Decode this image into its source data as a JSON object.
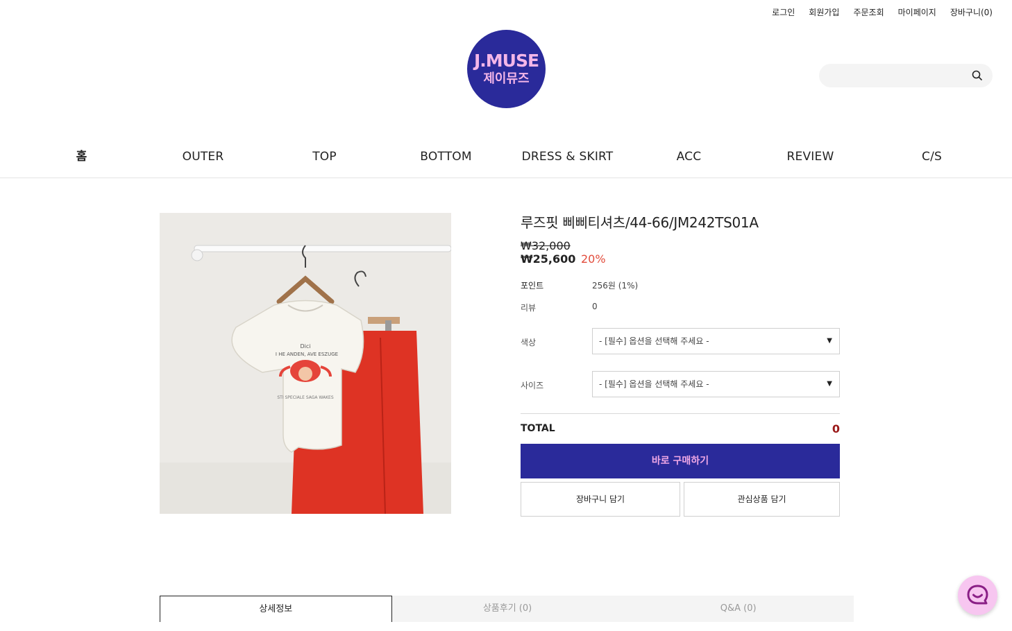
{
  "top_links": {
    "login": "로그인",
    "join": "회원가입",
    "order": "주문조회",
    "mypage": "마이페이지",
    "cart": "장바구니(0)"
  },
  "logo": {
    "en": "J.MUSE",
    "ko": "제이뮤즈"
  },
  "search": {
    "placeholder": ""
  },
  "nav": {
    "home": "홈",
    "outer": "OUTER",
    "top": "TOP",
    "bottom": "BOTTOM",
    "dress": "DRESS & SKIRT",
    "acc": "ACC",
    "review": "REVIEW",
    "cs": "C/S"
  },
  "product": {
    "title": "루즈핏 삐삐티셔츠/44-66/JM242TS01A",
    "price_original": "₩32,000",
    "price_sale": "₩25,600",
    "discount": "20%",
    "point_label": "포인트",
    "point_value": "256원 (1%)",
    "review_label": "리뷰",
    "review_value": "0",
    "color_label": "색상",
    "color_option": "- [필수] 옵션을 선택해 주세요 -",
    "size_label": "사이즈",
    "size_option": "- [필수] 옵션을 선택해 주세요 -",
    "total_label": "TOTAL",
    "total_value": "0",
    "buy_label": "바로 구매하기",
    "cart_label": "장바구니 담기",
    "wish_label": "관심상품 담기"
  },
  "tabs": {
    "detail": "상세정보",
    "review": "상품후기 (0)",
    "qna": "Q&A (0)"
  },
  "colors": {
    "brand": "#2a2a9a",
    "accent_pink": "#f4b6e8",
    "discount": "#e24b3b",
    "total": "#9b1a1a"
  }
}
